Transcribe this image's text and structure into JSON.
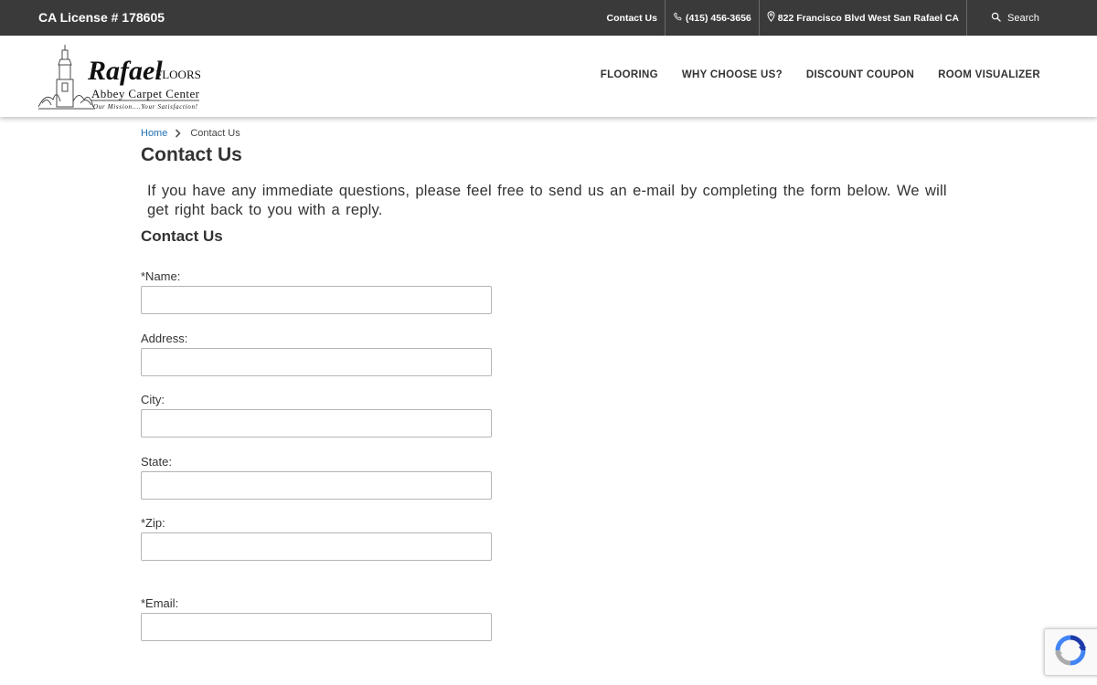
{
  "topbar": {
    "license": "CA License # 178605",
    "contact": "Contact Us",
    "phone": "(415) 456-3656",
    "address": "822 Francisco Blvd West San Rafael CA",
    "search": "Search"
  },
  "logo": {
    "brand": "Rafael",
    "floors": "FLOORS",
    "subtitle": "Abbey Carpet Center",
    "tagline": "Our Mission....Your Satisfaction!"
  },
  "nav": {
    "items": [
      "FLOORING",
      "WHY CHOOSE US?",
      "DISCOUNT COUPON",
      "ROOM VISUALIZER"
    ]
  },
  "breadcrumb": {
    "home": "Home",
    "current": "Contact Us"
  },
  "page": {
    "title": "Contact Us",
    "intro": "If you have any immediate questions, please feel free to send us an e-mail by completing the form below. We will get right back to you with a reply.",
    "section_title": "Contact Us"
  },
  "form": {
    "fields": [
      {
        "label": "*Name:",
        "value": ""
      },
      {
        "label": "Address:",
        "value": ""
      },
      {
        "label": "City:",
        "value": ""
      },
      {
        "label": "State:",
        "value": ""
      },
      {
        "label": "*Zip:",
        "value": ""
      },
      {
        "label": "*Email:",
        "value": ""
      }
    ]
  },
  "icons": {
    "phone": "phone-icon",
    "location": "map-pin-icon",
    "search": "search-icon",
    "chevron": "chevron-right-icon",
    "recaptcha": "recaptcha-icon"
  },
  "colors": {
    "topbar_bg": "#3a3a3a",
    "link_blue": "#1f6fb5",
    "text": "#333333"
  }
}
